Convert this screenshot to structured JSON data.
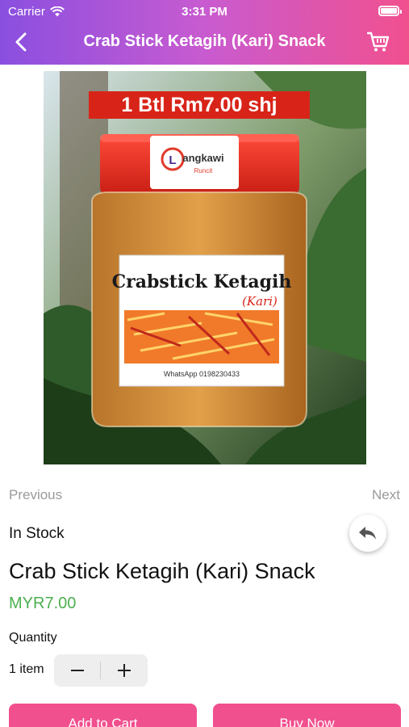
{
  "status_bar": {
    "carrier": "Carrier",
    "time": "3:31 PM"
  },
  "nav": {
    "title": "Crab Stick Ketagih (Kari) Snack",
    "back_icon": "chevron-left-icon",
    "cart_icon": "cart-icon"
  },
  "image": {
    "banner": "1 Btl Rm7.00 shj",
    "brand_name": "angkawi",
    "brand_initial": "L",
    "brand_sub": "Runcit",
    "label_title": "Crabstick Ketagih",
    "label_sub": "(Kari)",
    "label_phone": "WhatsApp 0198230433"
  },
  "pager": {
    "previous": "Previous",
    "next": "Next"
  },
  "product": {
    "stock_status": "In Stock",
    "title": "Crab Stick Ketagih (Kari) Snack",
    "price": "MYR7.00"
  },
  "quantity": {
    "label": "Quantity",
    "value": "1 item"
  },
  "actions": {
    "add_to_cart": "Add to Cart",
    "buy_now": "Buy Now"
  },
  "colors": {
    "accent": "#f1508f",
    "header_start": "#8a4fe0",
    "price": "#4caf50"
  }
}
